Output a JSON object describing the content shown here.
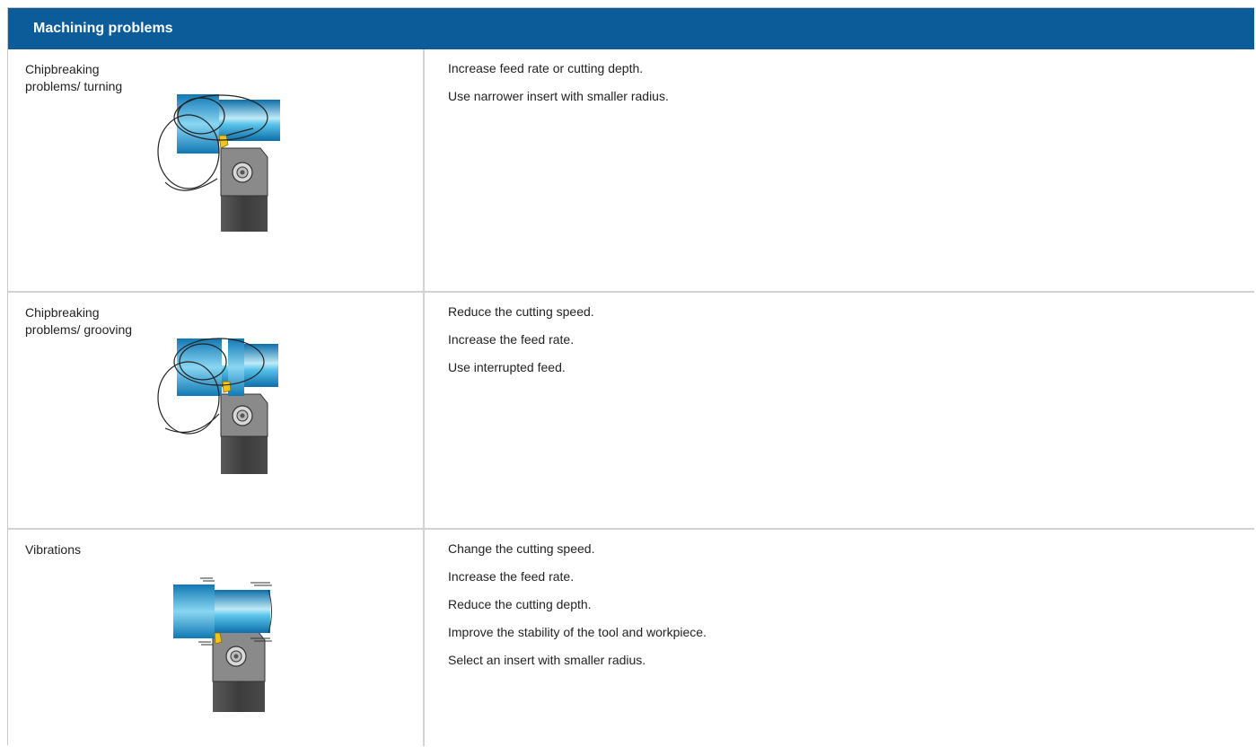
{
  "header": {
    "title": "Machining problems"
  },
  "rows": [
    {
      "problem": "Chipbreaking\nproblems/ turning",
      "illustration": "turning-chip-icon",
      "solutions": [
        "Increase feed rate or cutting depth.",
        "Use narrower insert with smaller radius."
      ]
    },
    {
      "problem": "Chipbreaking\nproblems/ grooving",
      "illustration": "grooving-chip-icon",
      "solutions": [
        "Reduce the cutting speed.",
        "Increase the feed rate.",
        "Use interrupted feed."
      ]
    },
    {
      "problem": "Vibrations",
      "illustration": "vibration-icon",
      "solutions": [
        "Change the cutting speed.",
        "Increase the feed rate.",
        "Reduce the cutting depth.",
        "Improve the stability of the tool and workpiece.",
        "Select an insert with smaller radius."
      ]
    }
  ],
  "colors": {
    "header_bg": "#0b5c99",
    "header_text": "#ffffff",
    "workpiece": "#2aa7d6",
    "holder": "#4a4a4a",
    "insert": "#f0c419",
    "divider": "#d2d2d2"
  }
}
